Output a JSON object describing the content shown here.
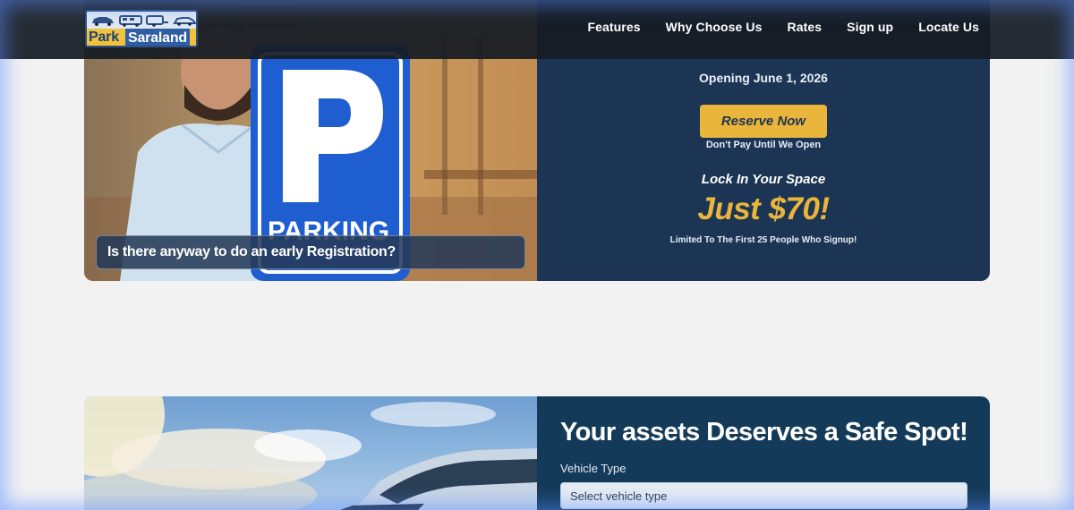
{
  "header": {
    "logo_text_1": "Park",
    "logo_text_2": "Saraland",
    "nav": [
      "Features",
      "Why Choose Us",
      "Rates",
      "Sign up",
      "Locate Us"
    ]
  },
  "hero": {
    "photo_sign_text": "PARKING",
    "question": "Is there anyway to do an early Registration?",
    "opening": "Opening June 1, 2026",
    "reserve_button": "Reserve Now",
    "dont_pay": "Don't Pay Until We Open",
    "lock_in": "Lock In Your Space",
    "price": "Just $70!",
    "limited": "Limited To The First 25 People Who Signup!"
  },
  "signup_form": {
    "title": "Your assets Deserves a Safe Spot!",
    "vehicle_type_label": "Vehicle Type",
    "vehicle_type_placeholder": "Select vehicle type"
  },
  "colors": {
    "header_bg": "#161c24",
    "panel_navy": "#1c3554",
    "form_panel": "#143a59",
    "accent_gold": "#e9b63b",
    "page_bg": "#f2f2f2"
  }
}
